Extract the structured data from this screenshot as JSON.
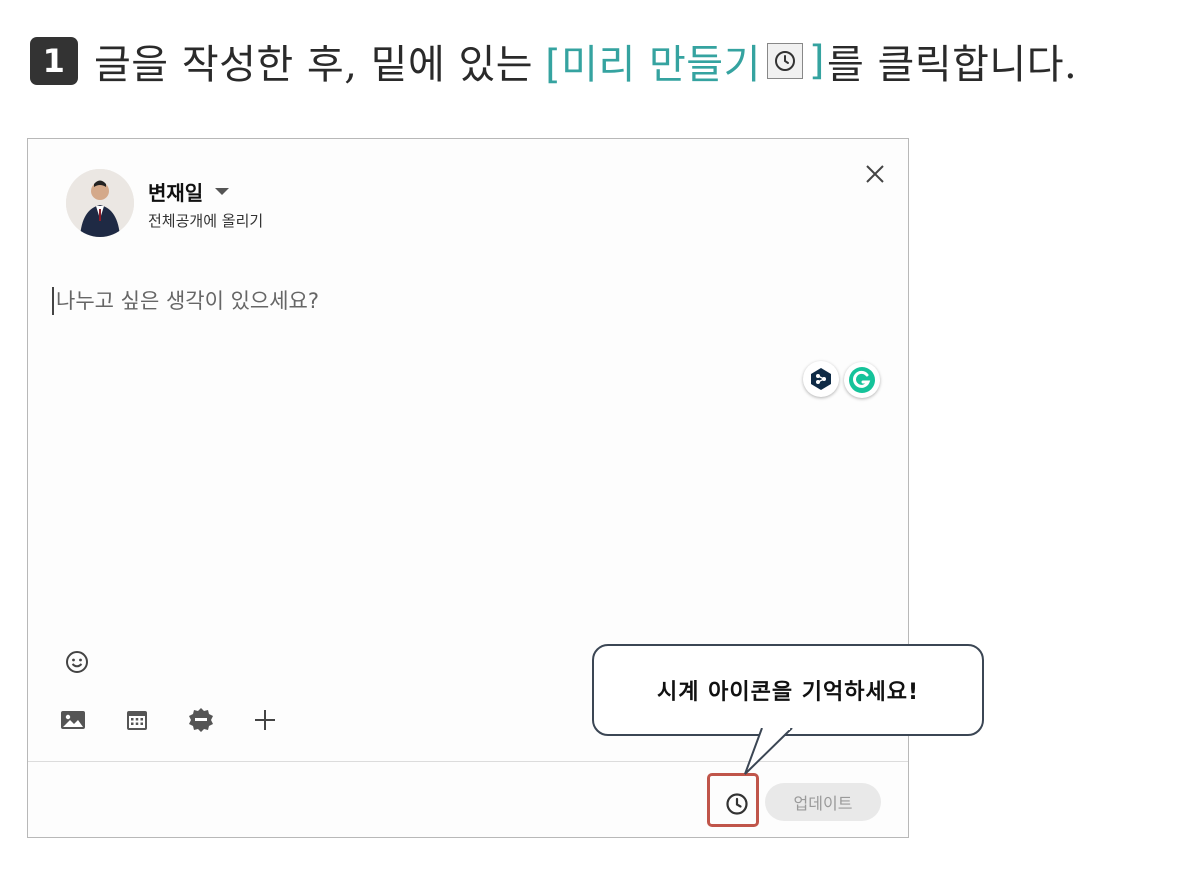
{
  "instruction": {
    "step_number": "1",
    "text_before": "글을 작성한 후, 밑에 있는",
    "highlight_open": "[미리 만들기",
    "highlight_close": "]",
    "text_after": "를 클릭합니다."
  },
  "composer": {
    "author_name": "변재일",
    "visibility": "전체공개에 올리기",
    "placeholder": "나누고 싶은 생각이 있으세요?",
    "update_button": "업데이트",
    "icons": {
      "close": "close-icon",
      "emoji": "smiley-icon",
      "photo": "image-icon",
      "event": "calendar-icon",
      "celebrate": "badge-icon",
      "more": "plus-icon",
      "schedule": "clock-icon",
      "deepl": "deepl-icon",
      "grammarly": "grammarly-icon"
    }
  },
  "callout": {
    "text": "시계 아이콘을 기억하세요!"
  },
  "colors": {
    "accent": "#35a3a0",
    "highlight_border": "#c0554a",
    "callout_border": "#3b4654"
  }
}
